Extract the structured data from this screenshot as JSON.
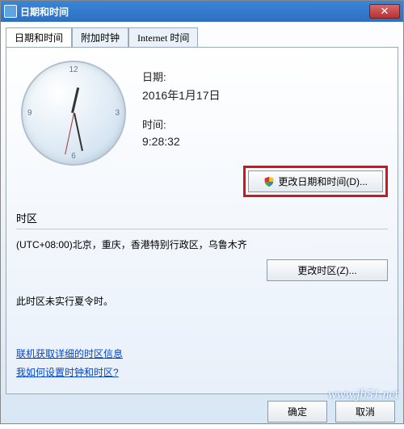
{
  "window": {
    "title": "日期和时间",
    "close_glyph": "✕"
  },
  "tabs": [
    {
      "label": "日期和时间"
    },
    {
      "label": "附加时钟"
    },
    {
      "label": "Internet 时间"
    }
  ],
  "datetime": {
    "date_label": "日期:",
    "date_value": "2016年1月17日",
    "time_label": "时间:",
    "time_value": "9:28:32",
    "change_datetime_btn": "更改日期和时间(D)..."
  },
  "timezone": {
    "heading": "时区",
    "value": "(UTC+08:00)北京，重庆，香港特别行政区，乌鲁木齐",
    "change_tz_btn": "更改时区(Z)...",
    "dst_note": "此时区未实行夏令时。"
  },
  "links": {
    "tz_info": "联机获取详细的时区信息",
    "how_to": "我如何设置时钟和时区?"
  },
  "footer": {
    "ok": "确定",
    "cancel": "取消"
  },
  "watermark": "www.jb51.net"
}
